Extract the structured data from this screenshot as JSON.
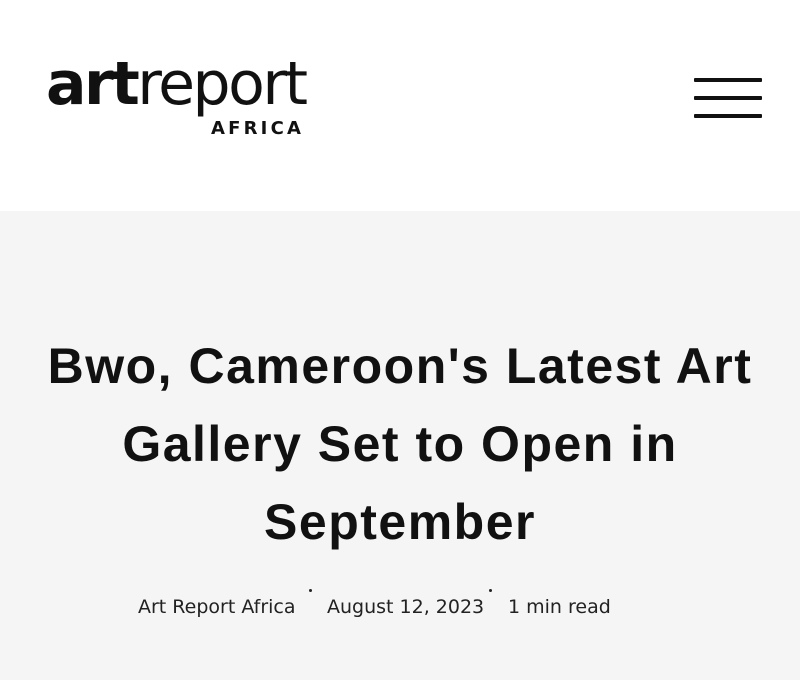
{
  "header": {
    "logo": {
      "main_bold": "art",
      "main_light": "report",
      "sub": "AFRICA"
    },
    "menu_icon": "hamburger-menu-icon"
  },
  "article": {
    "title": "Bwo, Cameroon's Latest Art Gallery Set to Open in September",
    "author": "Art Report Africa",
    "date": "August 12, 2023",
    "read_time": "1 min read"
  },
  "colors": {
    "header_background": "#ffffff",
    "hero_background": "#f5f5f5",
    "text": "#111111"
  }
}
